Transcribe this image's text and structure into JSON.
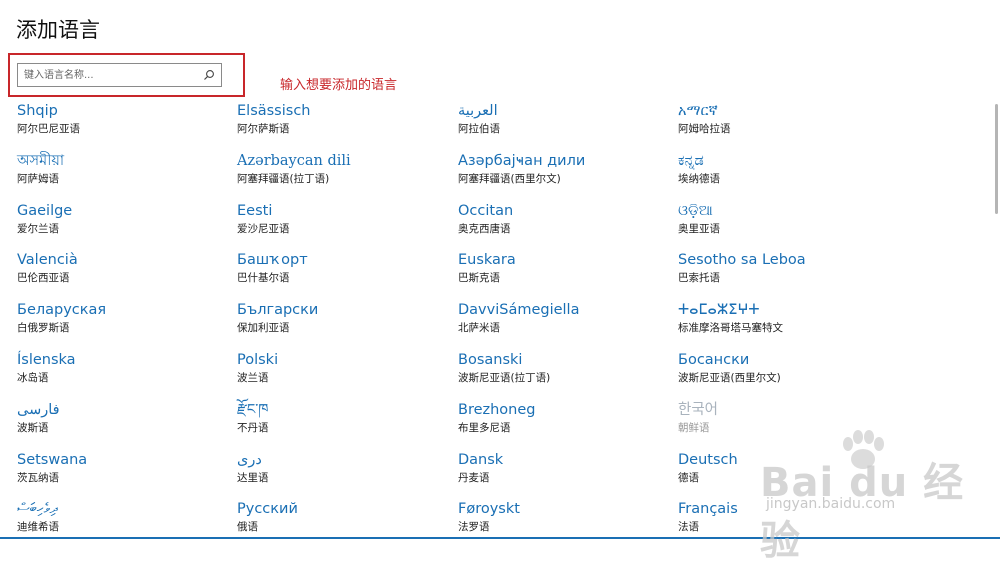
{
  "page": {
    "title": "添加语言",
    "annotation": "输入想要添加的语言"
  },
  "search": {
    "placeholder": "键入语言名称...",
    "value": "",
    "icon": "search-icon"
  },
  "languages": [
    {
      "native": "Shqip",
      "name": "阿尔巴尼亚语"
    },
    {
      "native": "Elsässisch",
      "name": "阿尔萨斯语"
    },
    {
      "native": "العربية",
      "name": "阿拉伯语"
    },
    {
      "native": "አማርኛ",
      "name": "阿姆哈拉语"
    },
    {
      "native": "অসমীয়া",
      "name": "阿萨姆语"
    },
    {
      "native": "Azərbaycan dili",
      "name": "阿塞拜疆语(拉丁语)"
    },
    {
      "native": "Азәрбајҹан дили",
      "name": "阿塞拜疆语(西里尔文)"
    },
    {
      "native": "ಕನ್ನಡ",
      "name": "埃纳德语"
    },
    {
      "native": "Gaeilge",
      "name": "爱尔兰语"
    },
    {
      "native": "Eesti",
      "name": "爱沙尼亚语"
    },
    {
      "native": "Occitan",
      "name": "奥克西唐语"
    },
    {
      "native": "ଓଡ଼ିଆ",
      "name": "奥里亚语"
    },
    {
      "native": "Valencià",
      "name": "巴伦西亚语"
    },
    {
      "native": "Башҡорт",
      "name": "巴什基尔语"
    },
    {
      "native": "Euskara",
      "name": "巴斯克语"
    },
    {
      "native": "Sesotho sa Leboa",
      "name": "巴索托语"
    },
    {
      "native": "Беларуская",
      "name": "白俄罗斯语"
    },
    {
      "native": "Български",
      "name": "保加利亚语"
    },
    {
      "native": "DavviSámegiella",
      "name": "北萨米语"
    },
    {
      "native": "ⵜⴰⵎⴰⵣⵉⵖⵜ",
      "name": "标准摩洛哥塔马塞特文"
    },
    {
      "native": "Íslenska",
      "name": "冰岛语"
    },
    {
      "native": "Polski",
      "name": "波兰语"
    },
    {
      "native": "Bosanski",
      "name": "波斯尼亚语(拉丁语)"
    },
    {
      "native": "Босански",
      "name": "波斯尼亚语(西里尔文)"
    },
    {
      "native": "فارسی",
      "name": "波斯语"
    },
    {
      "native": "རྫོང་ཁ",
      "name": "不丹语"
    },
    {
      "native": "Brezhoneg",
      "name": "布里多尼语"
    },
    {
      "native": "한국어",
      "name": "朝鲜语",
      "disabled": true
    },
    {
      "native": "Setswana",
      "name": "茨瓦纳语"
    },
    {
      "native": "دری",
      "name": "达里语"
    },
    {
      "native": "Dansk",
      "name": "丹麦语"
    },
    {
      "native": "Deutsch",
      "name": "德语"
    },
    {
      "native": "ދިވެހިބަސް",
      "name": "迪维希语"
    },
    {
      "native": "Русский",
      "name": "俄语"
    },
    {
      "native": "Føroyskt",
      "name": "法罗语"
    },
    {
      "native": "Français",
      "name": "法语"
    }
  ],
  "colors": {
    "accent": "#1a6fb4",
    "highlight": "#c8262a",
    "disabled": "#a9b3bd"
  },
  "watermark": {
    "brand": "Bai du 经验",
    "url": "jingyan.baidu.com"
  }
}
